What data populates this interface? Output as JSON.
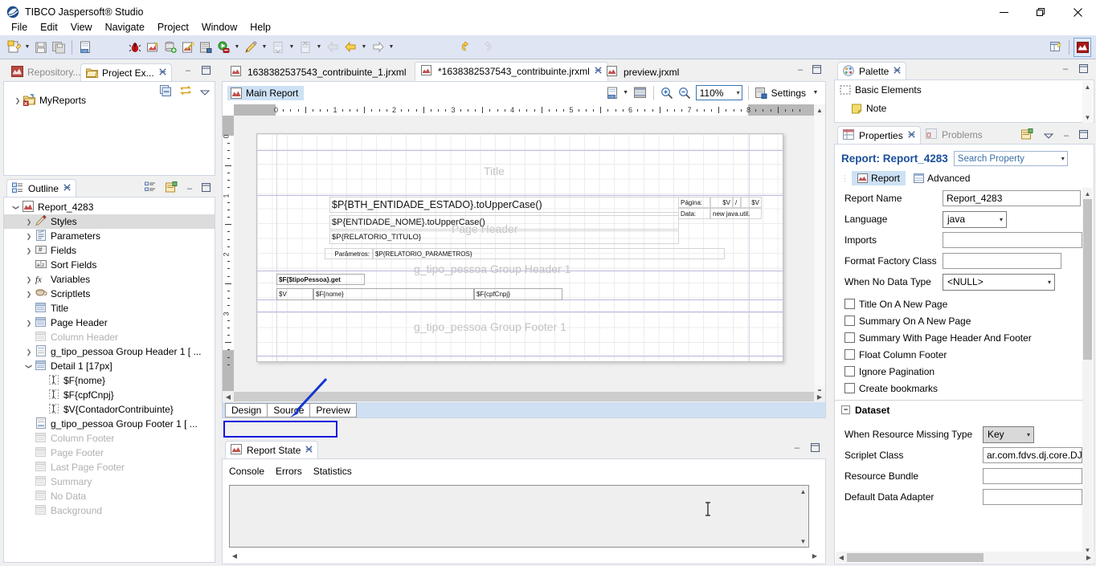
{
  "window": {
    "title": "TIBCO Jaspersoft® Studio",
    "icon": "jaspersoft-logo-icon",
    "minimize": "—",
    "maximize": "❐",
    "close": "✕"
  },
  "menubar": {
    "items": [
      "File",
      "Edit",
      "View",
      "Navigate",
      "Project",
      "Window",
      "Help"
    ]
  },
  "toolbar": {
    "groups": [
      {
        "icons": [
          "new-file-icon",
          "dropdown-arrow",
          "save-icon",
          "save-all-icon",
          "separator",
          "source-010-icon"
        ]
      },
      {
        "icons": [
          "debug-bug-icon",
          "run-report-icon",
          "datasource-add-icon",
          "wizard-wand-icon",
          "compile-icon",
          "preview-run-icon",
          "dropdown-arrow",
          "pencil-icon",
          "dropdown-arrow",
          "export-icon",
          "dropdown-arrow",
          "import-icon",
          "dropdown-arrow",
          "back-gray-icon",
          "back-icon",
          "dropdown-arrow",
          "forward-icon",
          "dropdown-arrow"
        ]
      },
      {
        "icons": [
          "undo-icon",
          "redo-icon"
        ]
      }
    ],
    "right_icons": [
      "new-perspective-icon",
      "jaspersoft-perspective-icon"
    ]
  },
  "project_explorer": {
    "tabs": [
      {
        "label": "Repository...",
        "active": false,
        "icon": "repository-icon"
      },
      {
        "label": "Project Ex...",
        "active": true,
        "icon": "project-explorer-icon",
        "closeable": true
      }
    ],
    "toolbar_icons": [
      "collapse-all-icon",
      "link-editor-icon",
      "view-menu-icon"
    ],
    "minimize": "–",
    "maximize": "❐",
    "tree": [
      {
        "label": "MyReports",
        "icon": "project-folder-icon",
        "twisty": "collapsed",
        "indent": 0
      }
    ]
  },
  "outline": {
    "tab_label": "Outline",
    "tab_icon": "outline-icon",
    "toolbar_icons": [
      "sort-tree-icon",
      "show-properties-icon"
    ],
    "minimize": "–",
    "maximize": "❐",
    "tree": [
      {
        "label": "Report_4283",
        "icon": "report-icon",
        "twisty": "expanded",
        "indent": 0,
        "dim": false
      },
      {
        "label": "Styles",
        "icon": "styles-icon",
        "twisty": "collapsed",
        "indent": 1,
        "dim": false,
        "selected": true
      },
      {
        "label": "Parameters",
        "icon": "parameters-icon",
        "twisty": "collapsed",
        "indent": 1,
        "dim": false
      },
      {
        "label": "Fields",
        "icon": "fields-icon",
        "twisty": "collapsed",
        "indent": 1,
        "dim": false
      },
      {
        "label": "Sort Fields",
        "icon": "sortfields-icon",
        "twisty": "none",
        "indent": 1,
        "dim": false
      },
      {
        "label": "Variables",
        "icon": "variables-fx-icon",
        "twisty": "collapsed",
        "indent": 1,
        "dim": false
      },
      {
        "label": "Scriptlets",
        "icon": "scriptlets-icon",
        "twisty": "collapsed",
        "indent": 1,
        "dim": false
      },
      {
        "label": "Title",
        "icon": "band-icon",
        "twisty": "none",
        "indent": 1,
        "dim": false
      },
      {
        "label": "Page Header",
        "icon": "band-icon",
        "twisty": "collapsed",
        "indent": 1,
        "dim": false
      },
      {
        "label": "Column Header",
        "icon": "band-icon",
        "twisty": "none",
        "indent": 1,
        "dim": true
      },
      {
        "label": "g_tipo_pessoa Group Header 1 [ ...",
        "icon": "group-band-icon",
        "twisty": "collapsed",
        "indent": 1,
        "dim": false
      },
      {
        "label": "Detail 1 [17px]",
        "icon": "band-icon",
        "twisty": "expanded",
        "indent": 1,
        "dim": false
      },
      {
        "label": "$F{nome}",
        "icon": "textfield-icon",
        "twisty": "none",
        "indent": 2,
        "dim": false
      },
      {
        "label": "$F{cpfCnpj}",
        "icon": "textfield-icon",
        "twisty": "none",
        "indent": 2,
        "dim": false
      },
      {
        "label": "$V{ContadorContribuinte}",
        "icon": "textfield-icon",
        "twisty": "none",
        "indent": 2,
        "dim": false
      },
      {
        "label": "g_tipo_pessoa Group Footer 1 [ ...",
        "icon": "group-footer-icon",
        "twisty": "none",
        "indent": 1,
        "dim": false
      },
      {
        "label": "Column Footer",
        "icon": "band-icon",
        "twisty": "none",
        "indent": 1,
        "dim": true
      },
      {
        "label": "Page Footer",
        "icon": "band-icon",
        "twisty": "none",
        "indent": 1,
        "dim": true
      },
      {
        "label": "Last Page Footer",
        "icon": "band-icon",
        "twisty": "none",
        "indent": 1,
        "dim": true
      },
      {
        "label": "Summary",
        "icon": "band-icon",
        "twisty": "none",
        "indent": 1,
        "dim": true
      },
      {
        "label": "No Data",
        "icon": "band-icon",
        "twisty": "none",
        "indent": 1,
        "dim": true
      },
      {
        "label": "Background",
        "icon": "band-icon",
        "twisty": "none",
        "indent": 1,
        "dim": true
      }
    ]
  },
  "editor": {
    "tabs": [
      {
        "label": "1638382537543_contribuinte_1.jrxml",
        "active": false,
        "closeable": false
      },
      {
        "label": "*1638382537543_contribuinte.jrxml",
        "active": true,
        "closeable": true
      },
      {
        "label": "preview.jrxml",
        "active": false,
        "closeable": false
      }
    ],
    "minimize": "–",
    "maximize": "❐",
    "toolbar": {
      "main_report_label": "Main Report",
      "icons": [
        "dataset-010-icon",
        "dropdown-arrow",
        "bands-list-icon",
        "zoom-in-icon",
        "zoom-out-icon"
      ],
      "zoom_value": "110%",
      "settings_label": "Settings"
    },
    "ruler": {
      "h_labels": [
        "0",
        "1",
        "2",
        "3",
        "4",
        "5",
        "6",
        "7",
        "8"
      ],
      "v_labels": [
        "0",
        "1",
        "2",
        "3"
      ]
    },
    "canvas": {
      "bands": [
        {
          "name": "Title",
          "label": "Title"
        },
        {
          "name": "Page Header",
          "label": "Page Header"
        },
        {
          "name": "g_tipo_pessoa Group Header 1",
          "label": "g_tipo_pessoa Group Header 1"
        },
        {
          "name": "g_tipo_pessoa Group Footer 1",
          "label": "g_tipo_pessoa Group Footer 1"
        }
      ],
      "elements": [
        {
          "text": "$P{BTH_ENTIDADE_ESTADO}.toUpperCase()",
          "size": "large"
        },
        {
          "text": "$P{ENTIDADE_NOME}.toUpperCase()",
          "size": "medium"
        },
        {
          "text": "$P{RELATORIO_TITULO}",
          "size": "small"
        },
        {
          "text": "Parâmetros:",
          "size": "tiny"
        },
        {
          "text": "$P{RELATORIO_PARAMETROS}",
          "size": "tiny"
        },
        {
          "text": "Página:",
          "size": "tiny"
        },
        {
          "text": "$V",
          "size": "tiny"
        },
        {
          "text": "/",
          "size": "tiny"
        },
        {
          "text": "$V",
          "size": "tiny"
        },
        {
          "text": "Data:",
          "size": "tiny"
        },
        {
          "text": "new java.util.",
          "size": "tiny"
        },
        {
          "text": "$F{$tipoPessoa}.get",
          "size": "tiny-bold"
        },
        {
          "text": "$V",
          "size": "tiny"
        },
        {
          "text": "$F{nome}",
          "size": "tiny"
        },
        {
          "text": "$F{cpfCnpj}",
          "size": "tiny"
        }
      ]
    },
    "design_tabs": [
      {
        "label": "Design",
        "active": true
      },
      {
        "label": "Source",
        "active": false
      },
      {
        "label": "Preview",
        "active": false
      }
    ]
  },
  "report_state": {
    "tab_label": "Report State",
    "tab_icon": "report-icon",
    "minimize": "–",
    "maximize": "❐",
    "subtabs": [
      "Console",
      "Errors",
      "Statistics"
    ],
    "console_text": ""
  },
  "palette": {
    "tab_label": "Palette",
    "tab_icon": "palette-icon",
    "minimize": "–",
    "maximize": "❐",
    "sections": [
      {
        "label": "Basic Elements",
        "icon": "basic-elements-icon"
      }
    ],
    "items": [
      {
        "label": "Note",
        "icon": "note-icon"
      }
    ]
  },
  "properties": {
    "tabs": [
      {
        "label": "Properties",
        "active": true,
        "icon": "properties-icon",
        "closeable": true
      },
      {
        "label": "Problems",
        "active": false,
        "icon": "problems-icon",
        "closeable": false
      }
    ],
    "toolbar_icons": [
      "pin-properties-icon",
      "view-menu-arrow"
    ],
    "minimize": "–",
    "maximize": "❐",
    "title": "Report: Report_4283",
    "search_placeholder": "Search Property",
    "section_tabs": [
      {
        "label": "Report",
        "active": true,
        "icon": "report-icon"
      },
      {
        "label": "Advanced",
        "active": false,
        "icon": "advanced-icon"
      }
    ],
    "fields": [
      {
        "label": "Report Name",
        "type": "text",
        "value": "Report_4283"
      },
      {
        "label": "Language",
        "type": "select",
        "value": "java"
      },
      {
        "label": "Imports",
        "type": "text",
        "value": ""
      },
      {
        "label": "Format Factory Class",
        "type": "text",
        "value": ""
      },
      {
        "label": "When No Data Type",
        "type": "select-wide",
        "value": "<NULL>"
      }
    ],
    "checkboxes": [
      {
        "label": "Title On A New Page",
        "checked": false
      },
      {
        "label": "Summary On A New Page",
        "checked": false
      },
      {
        "label": "Summary With Page Header And Footer",
        "checked": false
      },
      {
        "label": "Float Column Footer",
        "checked": false
      },
      {
        "label": "Ignore Pagination",
        "checked": false
      },
      {
        "label": "Create bookmarks",
        "checked": false
      }
    ],
    "dataset_section": {
      "label": "Dataset",
      "expander": "−",
      "fields": [
        {
          "label": "When Resource Missing Type",
          "type": "select-gray",
          "value": "Key"
        },
        {
          "label": "Scriplet Class",
          "type": "text",
          "value": "ar.com.fdvs.dj.core.DJDe"
        },
        {
          "label": "Resource Bundle",
          "type": "text",
          "value": ""
        },
        {
          "label": "Default Data Adapter",
          "type": "text",
          "value": ""
        }
      ]
    }
  },
  "annotations": {
    "highlight_rect": {
      "target": "design-source-preview-tabs",
      "color": "#1414dc"
    },
    "arrow": {
      "from": "upper-right",
      "to": "design-source-preview-tabs",
      "color": "#1436d4"
    }
  },
  "colors": {
    "toolbar_bg": "#dfe5f3",
    "accent_blue": "#1a4f9c",
    "tab_selected": "#cde1f5",
    "annotation": "#1414dc",
    "panel_border": "#cfd6e4"
  }
}
